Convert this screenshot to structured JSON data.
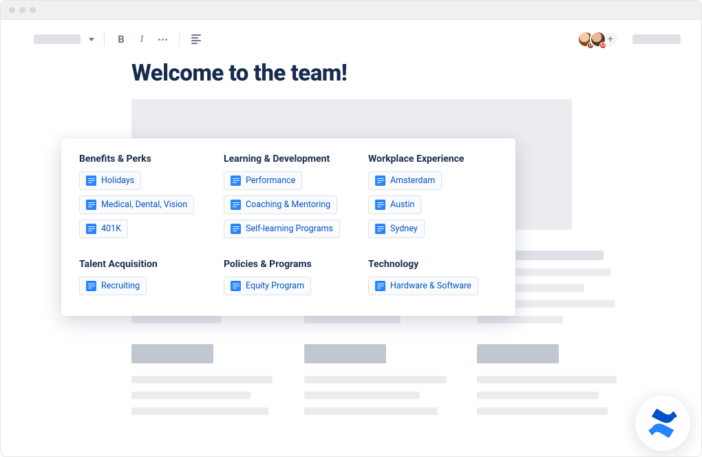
{
  "page": {
    "title": "Welcome to the team!"
  },
  "toolbar": {
    "avatar_badge_1": "R",
    "avatar_badge_2": "M",
    "more_symbol": "+"
  },
  "categories": [
    {
      "heading": "Benefits & Perks",
      "items": [
        "Holidays",
        "Medical, Dental, Vision",
        "401K"
      ]
    },
    {
      "heading": "Learning & Development",
      "items": [
        "Performance",
        "Coaching & Mentoring",
        "Self-learning Programs"
      ]
    },
    {
      "heading": "Workplace Experience",
      "items": [
        "Amsterdam",
        "Austin",
        "Sydney"
      ]
    },
    {
      "heading": "Talent Acquisition",
      "items": [
        "Recruiting"
      ]
    },
    {
      "heading": "Policies & Programs",
      "items": [
        "Equity Program"
      ]
    },
    {
      "heading": "Technology",
      "items": [
        "Hardware & Software"
      ]
    }
  ]
}
